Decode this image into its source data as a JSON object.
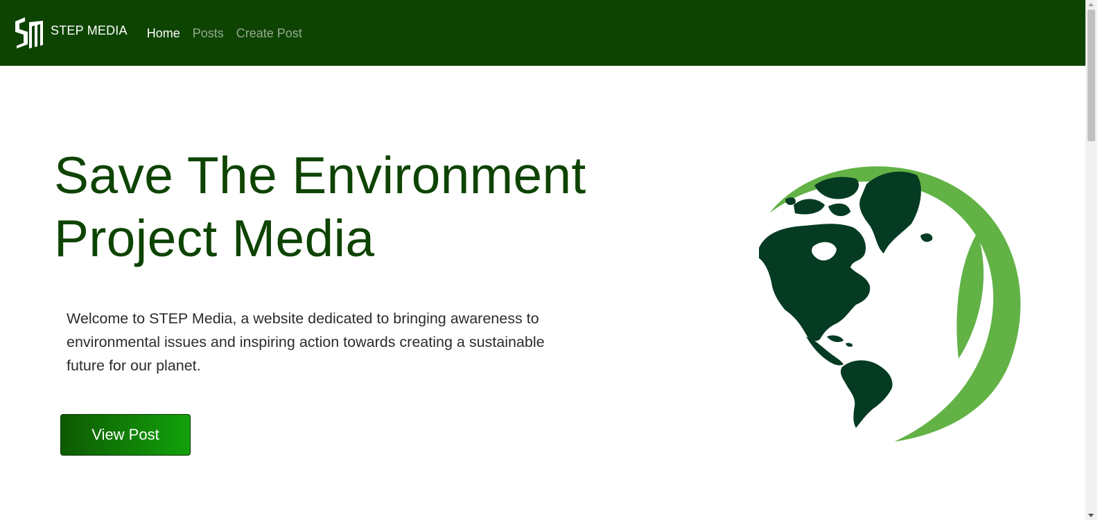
{
  "navbar": {
    "brand_text": "STEP MEDIA",
    "links": [
      {
        "label": "Home",
        "active": true
      },
      {
        "label": "Posts",
        "active": false
      },
      {
        "label": "Create Post",
        "active": false
      }
    ]
  },
  "hero": {
    "title_line1": "Save The Environment",
    "title_line2": "Project Media",
    "description": "Welcome to STEP Media, a website dedicated to bringing awareness to environmental issues and inspiring action towards creating a sustainable future for our planet.",
    "button_label": "View Post"
  },
  "icons": {
    "logo": "step-media-logo",
    "hero_image": "globe-leaf-illustration"
  },
  "colors": {
    "navbar_bg": "#0e4402",
    "title": "#0e4402",
    "button_start": "#0e5a02",
    "button_end": "#12a10b",
    "globe_land": "#053b22",
    "leaf": "#62b246"
  }
}
